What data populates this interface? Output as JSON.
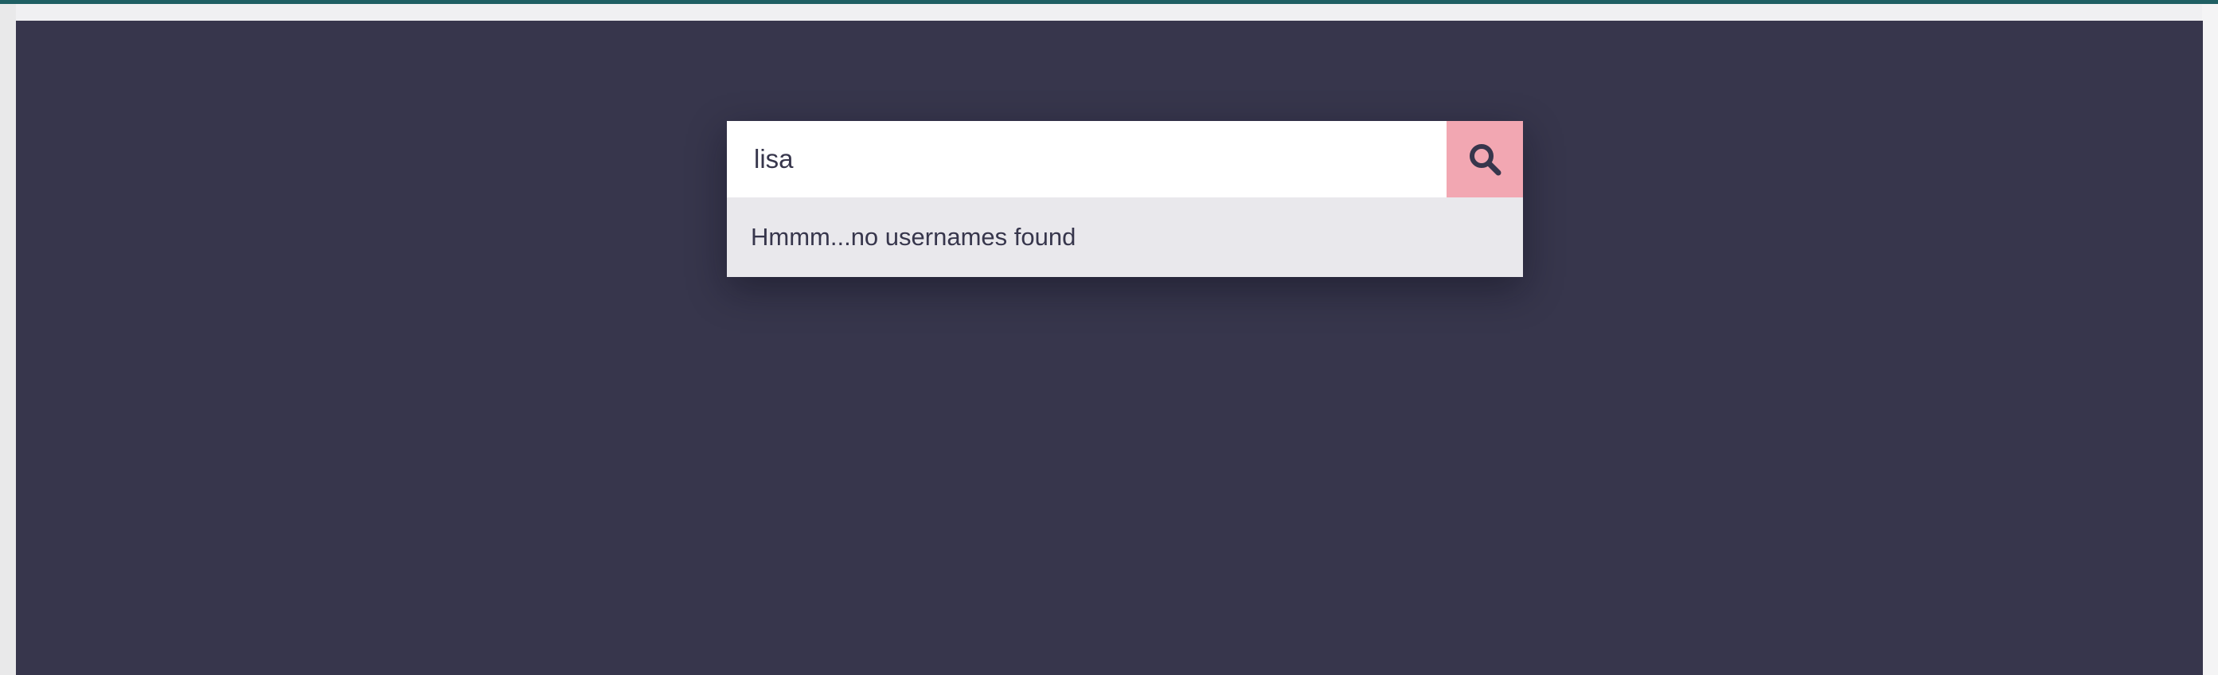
{
  "colors": {
    "stage_background": "#37364c",
    "accent_bar": "#1f5f63",
    "search_button": "#f2a7b2",
    "dropdown_background": "#e9e8ec",
    "text": "#37364c"
  },
  "search": {
    "value": "lisa",
    "button_icon": "search-icon"
  },
  "results": {
    "message": "Hmmm...no usernames found"
  }
}
